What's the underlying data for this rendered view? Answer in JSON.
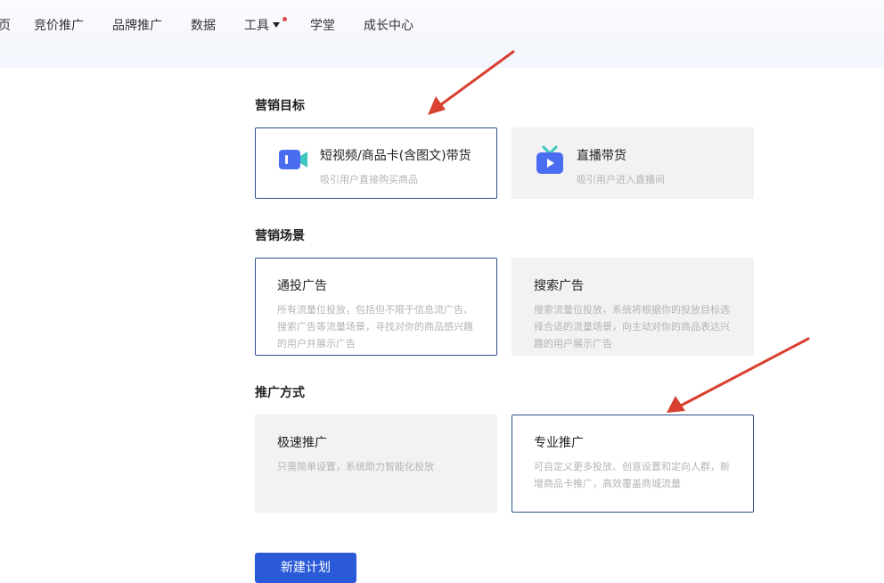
{
  "nav": {
    "items": [
      "页",
      "竞价推广",
      "品牌推广",
      "数据",
      "工具",
      "学堂",
      "成长中心"
    ]
  },
  "goal": {
    "title": "营销目标",
    "options": [
      {
        "label": "短视频/商品卡(含图文)带货",
        "desc": "吸引用户直接购买商品",
        "icon": "video-camera-icon",
        "selected": true
      },
      {
        "label": "直播带货",
        "desc": "吸引用户进入直播间",
        "icon": "tv-play-icon",
        "selected": false
      }
    ]
  },
  "scene": {
    "title": "营销场景",
    "options": [
      {
        "label": "通投广告",
        "desc": "所有流量位投放，包括但不限于信息流广告、搜索广告等流量场景，寻找对你的商品感兴趣的用户并展示广告",
        "selected": true
      },
      {
        "label": "搜索广告",
        "desc": "搜索流量位投放，系统将根据你的投放目标选择合适的流量场景，向主动对你的商品表达兴趣的用户展示广告",
        "selected": false
      }
    ]
  },
  "method": {
    "title": "推广方式",
    "options": [
      {
        "label": "极速推广",
        "desc": "只需简单设置，系统助力智能化投放",
        "selected": false
      },
      {
        "label": "专业推广",
        "desc": "可自定义更多投放、创意设置和定向人群，新增商品卡推广，高效覆盖商城流量",
        "selected": true
      }
    ]
  },
  "actions": {
    "create_label": "新建计划"
  },
  "colors": {
    "accent": "#2a5ad7",
    "active_border": "#2d4f86",
    "annotation_arrow": "#d8402f"
  }
}
